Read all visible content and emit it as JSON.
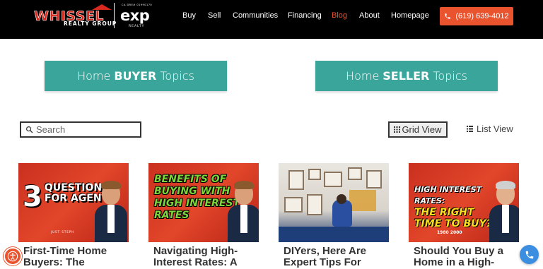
{
  "brand": {
    "logo_name": "WHISSEL",
    "logo_sub": "REALTY GROUP",
    "partner": "exp",
    "partner_sub": "REALTY",
    "dre": "CA DRE# 01990170"
  },
  "nav": {
    "items": [
      {
        "label": "Buy"
      },
      {
        "label": "Sell"
      },
      {
        "label": "Communities"
      },
      {
        "label": "Financing"
      },
      {
        "label": "Blog"
      },
      {
        "label": "About"
      },
      {
        "label": "Homepage"
      }
    ],
    "active": "Blog",
    "phone": "(619) 639-4012",
    "accent_color": "#e9542f"
  },
  "topics": {
    "buyer_prefix": "Home",
    "buyer_bold": "BUYER",
    "buyer_suffix": "Topics",
    "seller_prefix": "Home",
    "seller_bold": "SELLER",
    "seller_suffix": "Topics",
    "color": "#3aa59a"
  },
  "search": {
    "placeholder": "Search"
  },
  "views": {
    "grid_label": "Grid View",
    "list_label": "List View",
    "selected": "Grid View"
  },
  "cards": [
    {
      "title": "First-Time Home Buyers: The",
      "thumb_big": "3",
      "thumb_text": "QUESTIONS FOR AGENTS",
      "thumb_sub": "JUST STEPH"
    },
    {
      "title": "Navigating High-Interest Rates: A",
      "thumb_text": "BENEFITS OF BUYING WITH HIGH INTEREST RATES"
    },
    {
      "title": "DIYers, Here Are Expert Tips For"
    },
    {
      "title": "Should You Buy a Home in a High-",
      "thumb_line1": "HIGH INTEREST RATES:",
      "thumb_line2": "THE RIGHT TIME TO BUY?",
      "thumb_years": "1980   2000"
    }
  ]
}
